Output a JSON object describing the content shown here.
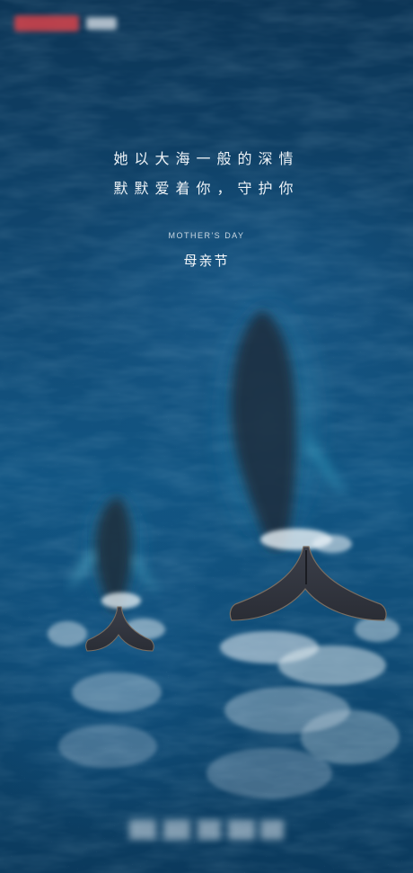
{
  "poster": {
    "headline_line1": "她以大海一般的深情",
    "headline_line2": "默默爱着你，守护你",
    "english_title": "MOTHER'S DAY",
    "chinese_title": "母亲节"
  },
  "colors": {
    "ocean": "#114a74",
    "text": "#eef3f7",
    "whale": "#2a2f38",
    "foam": "#e9f1f6"
  },
  "icons": {
    "top_logo": "brand-logo-blurred",
    "bottom_mark": "watermark-blurred"
  }
}
